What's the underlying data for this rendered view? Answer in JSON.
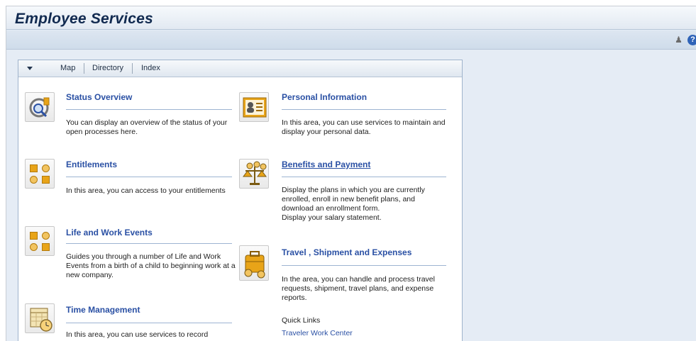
{
  "header": {
    "title": "Employee Services"
  },
  "toolbar": {
    "icons": [
      "person-icon",
      "help-icon"
    ]
  },
  "panel_header": {
    "links": [
      "Map",
      "Directory",
      "Index"
    ]
  },
  "services": {
    "status_overview": {
      "title": "Status Overview",
      "desc": "You can display an overview of the status of your open processes here."
    },
    "entitlements": {
      "title": "Entitlements",
      "desc": "In this area, you can access to your entitlements"
    },
    "life_work": {
      "title": "Life and Work Events",
      "desc": "Guides you through a number of Life and Work Events from a birth of a child to beginning work at a new company."
    },
    "time_management": {
      "title": "Time Management",
      "desc": "In this area, you can use services to record"
    },
    "personal_information": {
      "title": "Personal Information",
      "desc": "In this area, you can use services to maintain and display your personal data."
    },
    "benefits_payment": {
      "title": "Benefits and Payment",
      "desc": "Display the plans in which you are currently enrolled, enroll in new benefit plans, and download an enrollment form.",
      "desc2": "Display your salary statement."
    },
    "travel": {
      "title": "Travel , Shipment and Expenses",
      "desc": "In the area, you can handle and process travel requests, shipment, travel plans, and expense reports.",
      "quick_links_label": "Quick Links",
      "quick_link": "Traveler Work Center"
    }
  }
}
